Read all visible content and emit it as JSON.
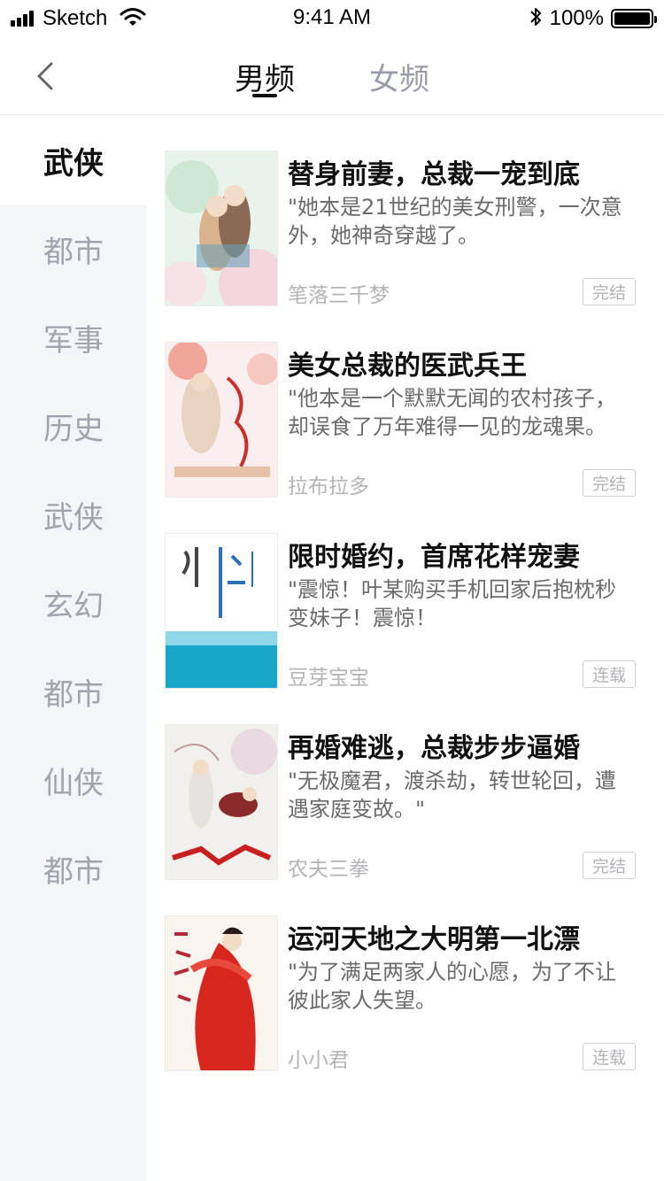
{
  "status_bar": {
    "carrier": "Sketch",
    "time": "9:41 AM",
    "battery": "100%"
  },
  "nav": {
    "tabs": [
      {
        "label": "男频",
        "active": true
      },
      {
        "label": "女频",
        "active": false
      }
    ]
  },
  "categories": [
    {
      "label": "武侠",
      "active": true
    },
    {
      "label": "都市",
      "active": false
    },
    {
      "label": "军事",
      "active": false
    },
    {
      "label": "历史",
      "active": false
    },
    {
      "label": "武侠",
      "active": false
    },
    {
      "label": "玄幻",
      "active": false
    },
    {
      "label": "都市",
      "active": false
    },
    {
      "label": "仙侠",
      "active": false
    },
    {
      "label": "都市",
      "active": false
    }
  ],
  "books": [
    {
      "title": "替身前妻，总裁一宠到底",
      "desc": "\"她本是21世纪的美女刑警，一次意外，她神奇穿越了。",
      "author": "笔落三千梦",
      "status": "完结"
    },
    {
      "title": "美女总裁的医武兵王",
      "desc": "\"他本是一个默默无闻的农村孩子，却误食了万年难得一见的龙魂果。",
      "author": "拉布拉多",
      "status": "完结"
    },
    {
      "title": "限时婚约，首席花样宠妻",
      "desc": "\"震惊！叶某购买手机回家后抱枕秒变妹子！震惊！",
      "author": "豆芽宝宝",
      "status": "连载"
    },
    {
      "title": "再婚难逃，总裁步步逼婚",
      "desc": "\"无极魔君，渡杀劫，转世轮回，遭遇家庭变故。\"",
      "author": "农夫三拳",
      "status": "完结"
    },
    {
      "title": "运河天地之大明第一北漂",
      "desc": "\"为了满足两家人的心愿，为了不让彼此家人失望。",
      "author": "小小君",
      "status": "连载"
    }
  ],
  "colors": {
    "active_text": "#111111",
    "inactive_tab": "#9a9ba8",
    "sidebar_bg": "#f4f5f9",
    "muted_text": "#b3b3b8"
  }
}
